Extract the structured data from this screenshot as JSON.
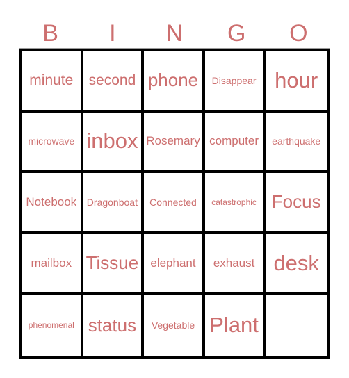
{
  "header": {
    "letters": [
      "B",
      "I",
      "N",
      "G",
      "O"
    ]
  },
  "colors": {
    "text": "#cd6f6f",
    "grid": "#000000",
    "background": "#ffffff"
  },
  "board": {
    "rows": [
      [
        "minute",
        "second",
        "phone",
        "Disappear",
        "hour"
      ],
      [
        "microwave",
        "inbox",
        "Rosemary",
        "computer",
        "earthquake"
      ],
      [
        "Notebook",
        "Dragonboat",
        "Connected",
        "catastrophic",
        "Focus"
      ],
      [
        "mailbox",
        "Tissue",
        "elephant",
        "exhaust",
        "desk"
      ],
      [
        "phenomenal",
        "status",
        "Vegetable",
        "Plant",
        ""
      ]
    ]
  }
}
